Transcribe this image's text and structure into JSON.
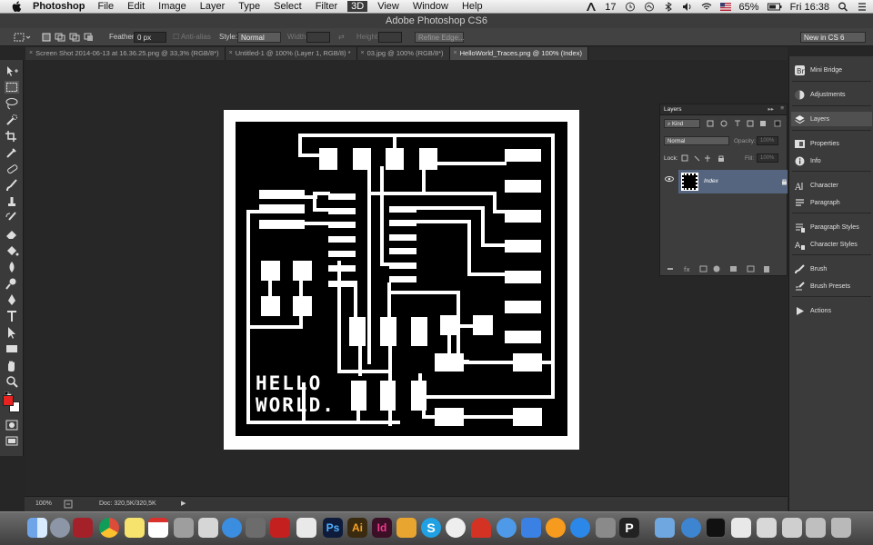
{
  "menubar": {
    "app": "Photoshop",
    "items": [
      "File",
      "Edit",
      "Image",
      "Layer",
      "Type",
      "Select",
      "Filter",
      "3D",
      "View",
      "Window",
      "Help"
    ],
    "active_item": "3D",
    "status": {
      "adobe_count": "17",
      "battery": "65%",
      "clock": "Fri 16:38"
    }
  },
  "window": {
    "title": "Adobe Photoshop CS6"
  },
  "options": {
    "feather_label": "Feather:",
    "feather_value": "0 px",
    "antialias": "Anti-alias",
    "style_label": "Style:",
    "style_value": "Normal",
    "width_label": "Width:",
    "height_label": "Height:",
    "refine": "Refine Edge...",
    "workspace": "New in CS 6"
  },
  "tabs": [
    {
      "label": "Screen Shot 2014-06-13 at 16.36.25.png @ 33,3% (RGB/8*)"
    },
    {
      "label": "Untitled-1 @ 100% (Layer 1, RGB/8) *"
    },
    {
      "label": "03.jpg @ 100% (RGB/8*)"
    },
    {
      "label": "HelloWorld_Traces.png @ 100% (Index)"
    }
  ],
  "document": {
    "line1": "HELLO",
    "line2": "WORLD."
  },
  "statusbar": {
    "zoom": "100%",
    "doc": "Doc: 320,5K/320,5K"
  },
  "right_panel": [
    {
      "label": "Mini Bridge",
      "icon": "mini-bridge-icon"
    },
    {
      "label": "Adjustments",
      "icon": "adjustments-icon"
    },
    {
      "label": "Layers",
      "icon": "layers-icon"
    },
    {
      "label": "Properties",
      "icon": "properties-icon"
    },
    {
      "label": "Info",
      "icon": "info-icon"
    },
    {
      "label": "Character",
      "icon": "character-icon"
    },
    {
      "label": "Paragraph",
      "icon": "paragraph-icon"
    },
    {
      "label": "Paragraph Styles",
      "icon": "paragraph-styles-icon"
    },
    {
      "label": "Character Styles",
      "icon": "character-styles-icon"
    },
    {
      "label": "Brush",
      "icon": "brush-icon"
    },
    {
      "label": "Brush Presets",
      "icon": "brush-presets-icon"
    },
    {
      "label": "Actions",
      "icon": "actions-icon"
    }
  ],
  "layers_panel": {
    "title": "Layers",
    "filter": "Kind",
    "blend": "Normal",
    "opacity_label": "Opacity:",
    "opacity_value": "100%",
    "lock_label": "Lock:",
    "fill_label": "Fill:",
    "fill_value": "100%",
    "layer_name": "Index"
  },
  "dock_items": [
    "Finder",
    "Launchpad",
    "Photo Booth",
    "Chrome",
    "Stickies",
    "Calendar",
    "Calculator",
    "Preview",
    "Messages",
    "FaceTime",
    "Photo",
    "Script Editor",
    "Flash",
    "Photoshop",
    "Illustrator",
    "InDesign",
    "Sketch",
    "Skype",
    "Eagle",
    "Inkscape",
    "iTunes",
    "iBooks",
    "App Store",
    "System Preferences",
    "Pulse",
    "Finder Folder",
    "i3D",
    "Terminal",
    "Screens",
    "Notes",
    "Trash"
  ],
  "colors": {
    "foreground": "#e8231f",
    "background": "#ffffff",
    "accent": "#55657f"
  }
}
